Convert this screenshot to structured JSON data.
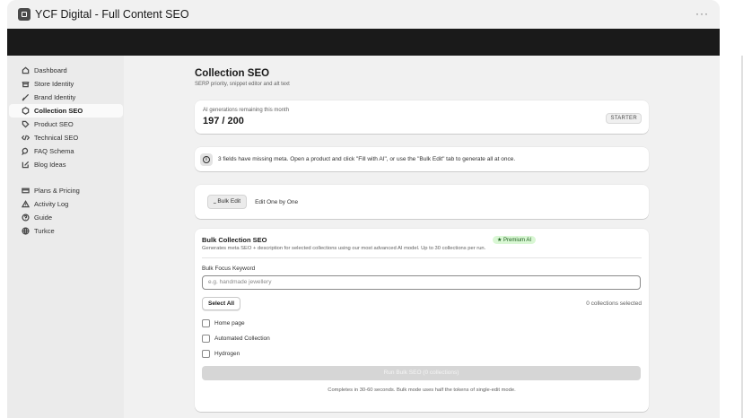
{
  "window": {
    "title": "YCF Digital - Full Content SEO",
    "icon": "app-icon",
    "more_label": "···"
  },
  "sidebar": {
    "items": [
      {
        "label": "Dashboard",
        "icon": "home-icon",
        "active": false
      },
      {
        "label": "Store Identity",
        "icon": "store-icon",
        "active": false
      },
      {
        "label": "Brand Identity",
        "icon": "brush-icon",
        "active": false
      },
      {
        "label": "Collection SEO",
        "icon": "collection-icon",
        "active": true
      },
      {
        "label": "Product SEO",
        "icon": "tag-icon",
        "active": false
      },
      {
        "label": "Technical SEO",
        "icon": "code-icon",
        "active": false
      },
      {
        "label": "FAQ Schema",
        "icon": "chat-icon",
        "active": false
      },
      {
        "label": "Blog Ideas",
        "icon": "edit-icon",
        "active": false
      }
    ],
    "secondary_items": [
      {
        "label": "Plans & Pricing",
        "icon": "card-icon"
      },
      {
        "label": "Activity Log",
        "icon": "alert-icon"
      },
      {
        "label": "Guide",
        "icon": "help-icon"
      },
      {
        "label": "Turkce",
        "icon": "globe-icon"
      }
    ]
  },
  "page": {
    "title": "Collection SEO",
    "subtitle": "SERP priority, snippet editor and alt text"
  },
  "generations": {
    "label": "AI generations remaining this month",
    "value": "197 / 200",
    "plan_badge": "STARTER"
  },
  "notice": {
    "icon": "info-icon",
    "text": "3 fields have missing meta. Open a product and click \"Fill with AI\", or use the \"Bulk Edit\" tab to generate all at once."
  },
  "tabs": [
    {
      "label": "⎵ Bulk Edit",
      "active": true
    },
    {
      "label": "Edit One by One",
      "active": false
    }
  ],
  "bulk": {
    "title": "Bulk Collection SEO",
    "premium_badge": "★ Premium AI",
    "description": "Generates meta SEO + description for selected collections using our most advanced AI model. Up to 30 collections per run.",
    "keyword_label": "Bulk Focus Keyword",
    "keyword_placeholder": "e.g. handmade jewellery",
    "select_all_label": "Select All",
    "selected_count": "0 collections selected",
    "collections": [
      {
        "label": "Home page",
        "checked": false
      },
      {
        "label": "Automated Collection",
        "checked": false
      },
      {
        "label": "Hydrogen",
        "checked": false
      }
    ],
    "run_label": "Run Bulk SEO (0 collections)",
    "footnote": "Completes in 30-60 seconds. Bulk mode uses half the tokens of single-edit mode."
  }
}
